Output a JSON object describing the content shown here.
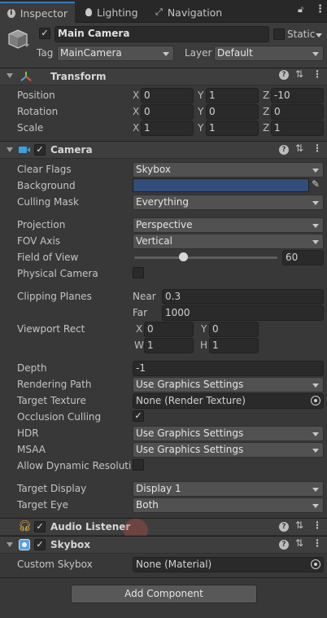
{
  "tabs": {
    "inspector": "Inspector",
    "lighting": "Lighting",
    "navigation": "Navigation"
  },
  "object": {
    "active": true,
    "name": "Main Camera",
    "static_label": "Static",
    "tag_label": "Tag",
    "tag_value": "MainCamera",
    "layer_label": "Layer",
    "layer_value": "Default"
  },
  "transform": {
    "title": "Transform",
    "rows": [
      {
        "label": "Position",
        "x": "0",
        "y": "1",
        "z": "-10"
      },
      {
        "label": "Rotation",
        "x": "0",
        "y": "0",
        "z": "0"
      },
      {
        "label": "Scale",
        "x": "1",
        "y": "1",
        "z": "1"
      }
    ],
    "axis_x": "X",
    "axis_y": "Y",
    "axis_z": "Z"
  },
  "camera": {
    "title": "Camera",
    "enabled": true,
    "clear_flags_label": "Clear Flags",
    "clear_flags_value": "Skybox",
    "background_label": "Background",
    "background_color": "#314d79",
    "culling_mask_label": "Culling Mask",
    "culling_mask_value": "Everything",
    "projection_label": "Projection",
    "projection_value": "Perspective",
    "fov_axis_label": "FOV Axis",
    "fov_axis_value": "Vertical",
    "fov_label": "Field of View",
    "fov_value": "60",
    "physical_label": "Physical Camera",
    "clipping_label": "Clipping Planes",
    "near_label": "Near",
    "near_value": "0.3",
    "far_label": "Far",
    "far_value": "1000",
    "viewport_label": "Viewport Rect",
    "vp_x_label": "X",
    "vp_x": "0",
    "vp_y_label": "Y",
    "vp_y": "0",
    "vp_w_label": "W",
    "vp_w": "1",
    "vp_h_label": "H",
    "vp_h": "1",
    "depth_label": "Depth",
    "depth_value": "-1",
    "rendering_path_label": "Rendering Path",
    "rendering_path_value": "Use Graphics Settings",
    "target_texture_label": "Target Texture",
    "target_texture_value": "None (Render Texture)",
    "occlusion_label": "Occlusion Culling",
    "occlusion_checked": true,
    "hdr_label": "HDR",
    "hdr_value": "Use Graphics Settings",
    "msaa_label": "MSAA",
    "msaa_value": "Use Graphics Settings",
    "dynamic_res_label": "Allow Dynamic Resolutio",
    "target_display_label": "Target Display",
    "target_display_value": "Display 1",
    "target_eye_label": "Target Eye",
    "target_eye_value": "Both"
  },
  "audio_listener": {
    "title": "Audio Listener",
    "enabled": true
  },
  "skybox": {
    "title": "Skybox",
    "enabled": true,
    "custom_label": "Custom Skybox",
    "custom_value": "None (Material)"
  },
  "add_component_label": "Add Component",
  "colors": {
    "accent": "#3a79bb",
    "panel": "#383838",
    "field": "#2a2a2a"
  }
}
